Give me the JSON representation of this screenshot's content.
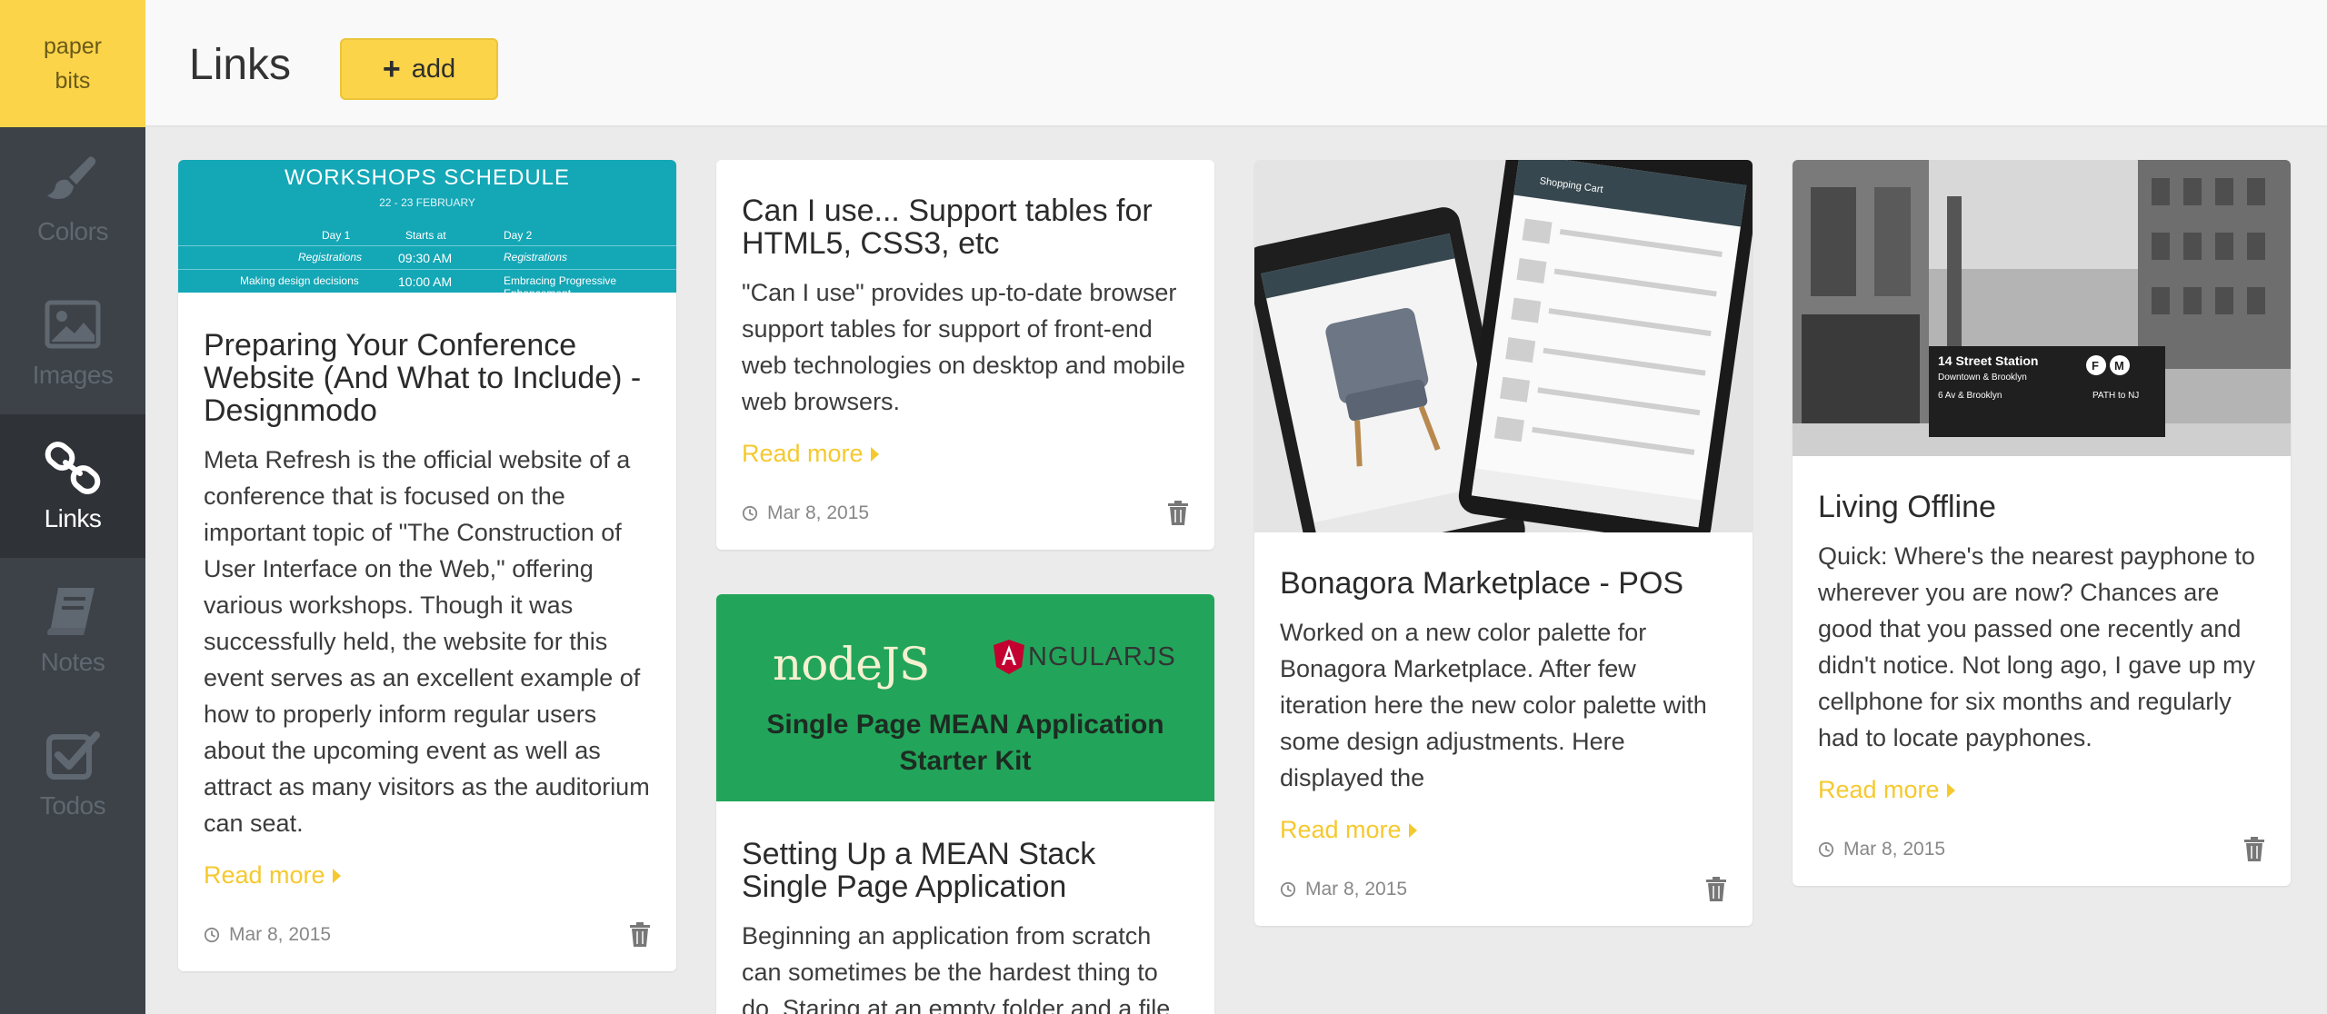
{
  "app": {
    "logo_line1": "paper",
    "logo_line2": "bits"
  },
  "sidebar": {
    "items": [
      {
        "label": "Colors",
        "icon": "brush-icon",
        "active": false
      },
      {
        "label": "Images",
        "icon": "image-icon",
        "active": false
      },
      {
        "label": "Links",
        "icon": "link-icon",
        "active": true
      },
      {
        "label": "Notes",
        "icon": "book-icon",
        "active": false
      },
      {
        "label": "Todos",
        "icon": "checkbox-icon",
        "active": false
      }
    ]
  },
  "header": {
    "title": "Links",
    "add_label": "add"
  },
  "colors": {
    "accent": "#fbd44a",
    "sidebar_bg": "#3d4248",
    "sidebar_active": "#2f3338",
    "read_more": "#f5c92e"
  },
  "cards": [
    {
      "image": {
        "title": "WORKSHOPS SCHEDULE",
        "subtitle": "22 - 23 FEBRUARY",
        "headers": [
          "Day 1",
          "Starts at",
          "Day 2"
        ],
        "row1": [
          "Registrations",
          "09:30 AM",
          "Registrations"
        ],
        "row2": [
          "Making design decisions",
          "10:00 AM",
          "Embracing Progressive Enhancement"
        ]
      },
      "title": "Preparing Your Conference Website (And What to Include) - Designmodo",
      "description": "Meta Refresh is the official website of a conference that is focused on the important topic of \"The Construction of User Interface on the Web,\" offering various workshops. Though it was successfully held, the website for this event serves as an excellent example of how to properly inform regular users about the upcoming event as well as attract as many visitors as the auditorium can seat.",
      "read_more": "Read more",
      "date": "Mar 8, 2015"
    },
    {
      "title": "Can I use... Support tables for HTML5, CSS3, etc",
      "description": "\"Can I use\" provides up-to-date browser support tables for support of front-end web technologies on desktop and mobile web browsers.",
      "read_more": "Read more",
      "date": "Mar 8, 2015"
    },
    {
      "image": {
        "logo_left": "nodeJS",
        "logo_right": "NGULARJS",
        "caption_line1": "Single Page MEAN Application",
        "caption_line2": "Starter Kit"
      },
      "title": "Setting Up a MEAN Stack Single Page Application",
      "description": "Beginning an application from scratch can sometimes be the hardest thing to do. Staring at an empty folder and a file"
    },
    {
      "image": {
        "screen_title": "Shopping Cart"
      },
      "title": "Bonagora Marketplace - POS",
      "description": "Worked on a new color palette for Bonagora Marketplace. After few iteration here the new color palette with some design adjustments. Here displayed the",
      "read_more": "Read more",
      "date": "Mar 8, 2015"
    },
    {
      "image": {
        "sign_title": "14 Street Station",
        "sign_sub": "Downtown & Brooklyn",
        "sign_line": "6 Av & Brooklyn",
        "sign_path": "PATH to NJ",
        "lines": [
          "F",
          "M"
        ]
      },
      "title": "Living Offline",
      "description": "Quick: Where's the nearest payphone to wherever you are now? Chances are good that you passed one recently and didn't notice. Not long ago, I gave up my cellphone for six months and regularly had to locate payphones.",
      "read_more": "Read more",
      "date": "Mar 8, 2015"
    }
  ]
}
